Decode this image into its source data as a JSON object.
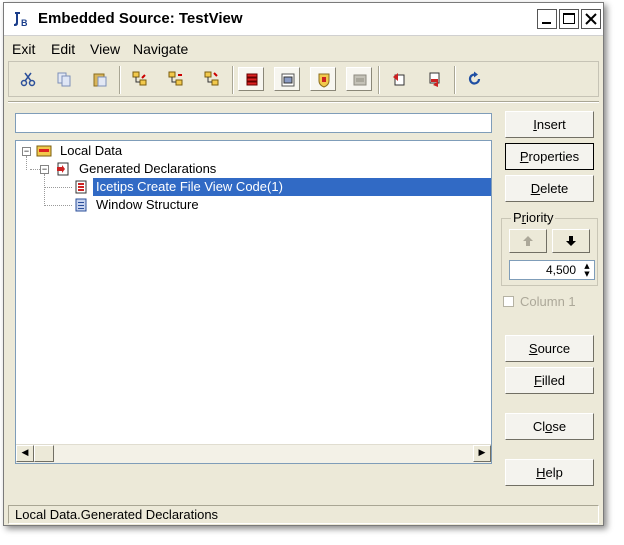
{
  "window": {
    "title": "Embedded Source: TestView"
  },
  "menu": {
    "items": [
      "Exit",
      "Edit",
      "View",
      "Navigate"
    ]
  },
  "search": {
    "value": "",
    "placeholder": ""
  },
  "tree": {
    "root": "Local Data",
    "child": "Generated Declarations",
    "leaf_selected": "Icetips Create File View Code(1)",
    "leaf_other": "Window Structure"
  },
  "buttons": {
    "insert": {
      "pre": "",
      "accel": "I",
      "post": "nsert"
    },
    "properties": {
      "pre": "",
      "accel": "P",
      "post": "roperties"
    },
    "delete": {
      "pre": "",
      "accel": "D",
      "post": "elete"
    },
    "source": {
      "pre": "",
      "accel": "S",
      "post": "ource"
    },
    "filled": {
      "pre": "",
      "accel": "F",
      "post": "illed"
    },
    "close": {
      "pre": "Cl",
      "accel": "o",
      "post": "se"
    },
    "help": {
      "pre": "",
      "accel": "H",
      "post": "elp"
    }
  },
  "priority": {
    "title_pre": "P",
    "title_accel": "r",
    "title_post": "iority",
    "value": "4,500"
  },
  "column": {
    "label": "Column 1",
    "checked": false
  },
  "status": {
    "text": "Local Data.Generated Declarations"
  },
  "colors": {
    "selection": "#316ac5",
    "face": "#ece9d8"
  }
}
